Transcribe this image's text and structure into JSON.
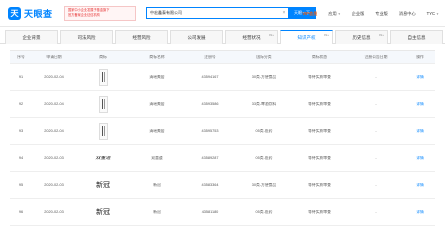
{
  "header": {
    "logo_text": "天眼查",
    "logo_mark": "天",
    "promo_lines": [
      "国家中小企业发展子基金旗下",
      "官方备案企业征信机构"
    ],
    "search_value": "中宏鑫泰有限公司",
    "search_button": "天眼一下",
    "nav": [
      {
        "label": "VIP会员",
        "vip": true
      },
      {
        "label": "应用"
      },
      {
        "label": "企业版"
      },
      {
        "label": "专业版"
      },
      {
        "label": "消息中心"
      },
      {
        "label": "TYC"
      }
    ]
  },
  "tabs": [
    {
      "label": "企业背景",
      "count": ""
    },
    {
      "label": "司法风险",
      "count": ""
    },
    {
      "label": "经营风险",
      "count": ""
    },
    {
      "label": "公司发展",
      "count": ""
    },
    {
      "label": "经营状况",
      "count": "99+"
    },
    {
      "label": "知识产权",
      "count": "99+",
      "active": true
    },
    {
      "label": "历史信息",
      "count": "99+"
    },
    {
      "label": "自主信息",
      "count": ""
    }
  ],
  "table": {
    "columns": [
      "序号",
      "申请日期",
      "商标",
      "商标名称",
      "注册号",
      "国际分类",
      "商标状态",
      "注册公告日期",
      "操作"
    ],
    "rows": [
      {
        "index": "91",
        "date": "2020-02-04",
        "mark_type": "image",
        "mark_text": "",
        "name": "清瑶美居",
        "reg_no": "43594167",
        "class": "30类-方便食品",
        "status": "等待实质审查",
        "notice_date": "-",
        "action": "详情"
      },
      {
        "index": "92",
        "date": "2020-02-04",
        "mark_type": "image",
        "mark_text": "",
        "name": "清瑶美居",
        "reg_no": "43593586",
        "class": "33类-啤酒饮料",
        "status": "等待实质审查",
        "notice_date": "-",
        "action": "详情"
      },
      {
        "index": "93",
        "date": "2020-02-04",
        "mark_type": "image",
        "mark_text": "",
        "name": "清瑶美居",
        "reg_no": "43595753",
        "class": "05类-医药",
        "status": "等待实质审查",
        "notice_date": "-",
        "action": "详情"
      },
      {
        "index": "94",
        "date": "2020-02-03",
        "mark_type": "script",
        "mark_text": "双董道",
        "name": "双董道",
        "reg_no": "43589287",
        "class": "05类-医药",
        "status": "等待实质审查",
        "notice_date": "-",
        "action": "详情"
      },
      {
        "index": "95",
        "date": "2020-02-03",
        "mark_type": "text",
        "mark_text": "新冠",
        "name": "新冠",
        "reg_no": "43583364",
        "class": "30类-方便食品",
        "status": "等待实质审查",
        "notice_date": "-",
        "action": "详情"
      },
      {
        "index": "96",
        "date": "2020-02-03",
        "mark_type": "text",
        "mark_text": "新冠",
        "name": "新冠",
        "reg_no": "43581180",
        "class": "05类-医药",
        "status": "等待实质审查",
        "notice_date": "-",
        "action": "详情"
      }
    ]
  }
}
